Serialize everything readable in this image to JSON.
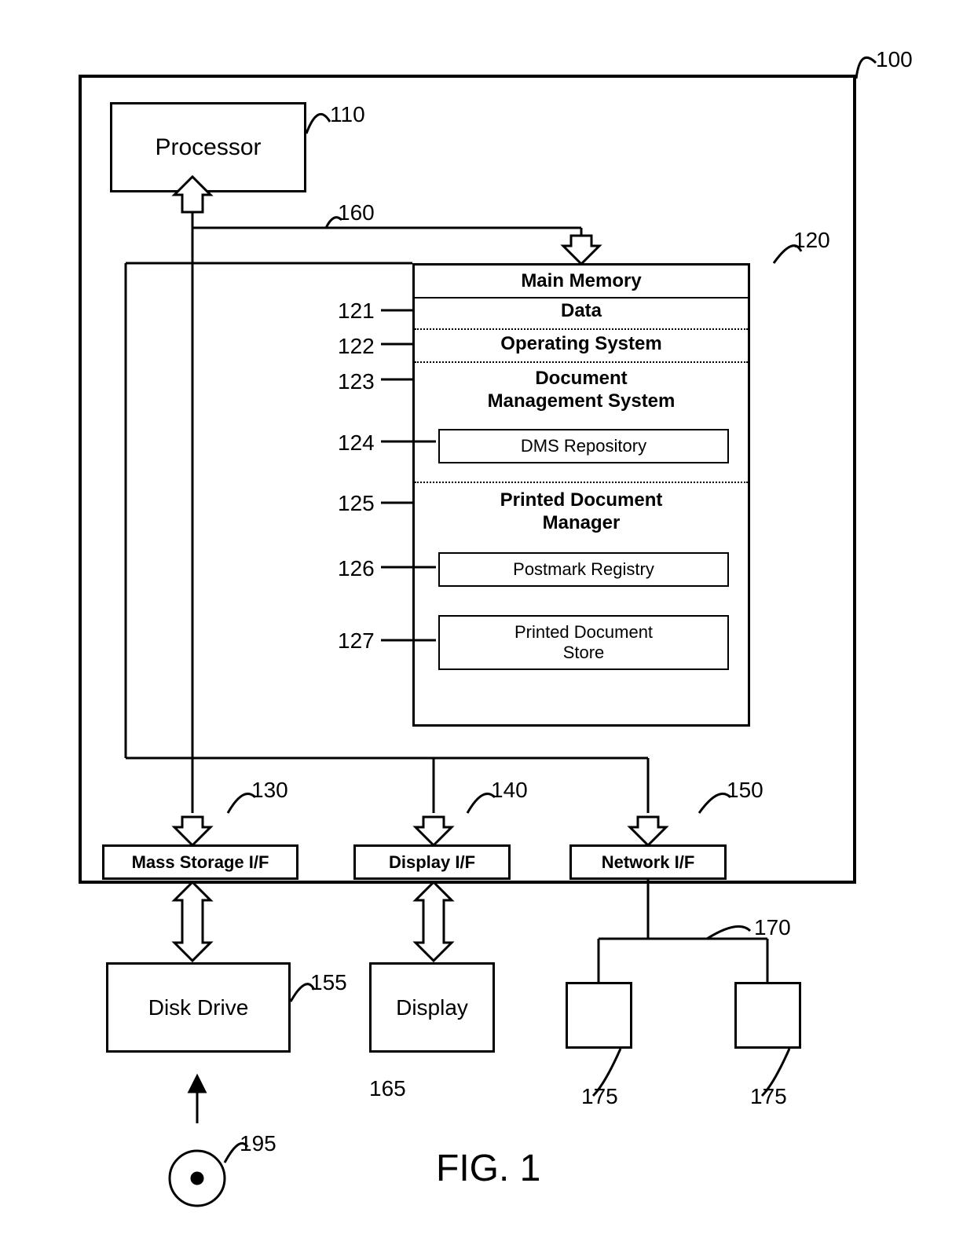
{
  "refs": {
    "r100": "100",
    "r110": "110",
    "r120": "120",
    "r121": "121",
    "r122": "122",
    "r123": "123",
    "r124": "124",
    "r125": "125",
    "r126": "126",
    "r127": "127",
    "r130": "130",
    "r140": "140",
    "r150": "150",
    "r155": "155",
    "r160": "160",
    "r165": "165",
    "r170": "170",
    "r175a": "175",
    "r175b": "175",
    "r195": "195"
  },
  "blocks": {
    "processor": "Processor",
    "main_memory": "Main Memory",
    "data": "Data",
    "os": "Operating System",
    "dms": "Document\nManagement System",
    "dms_repo": "DMS Repository",
    "pdm": "Printed Document\nManager",
    "postmark": "Postmark Registry",
    "pd_store": "Printed Document\nStore",
    "mass_storage": "Mass Storage I/F",
    "display_if": "Display I/F",
    "network_if": "Network I/F",
    "disk_drive": "Disk Drive",
    "display": "Display"
  },
  "figure": "FIG. 1"
}
